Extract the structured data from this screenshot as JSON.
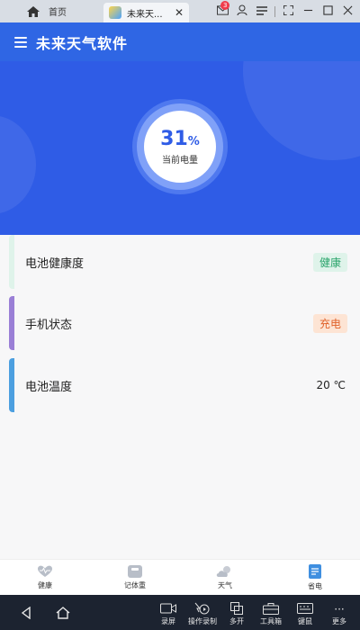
{
  "topbar": {
    "home_tab_label": "首页",
    "active_tab_label": "未来天...",
    "notification_count": "3",
    "close_symbol": "✕",
    "icons": [
      "home-icon",
      "mail-icon",
      "user-icon",
      "menu-icon",
      "screenshot-icon",
      "minimize-icon",
      "maximize-icon",
      "close-icon"
    ]
  },
  "app": {
    "title": "未来天气软件",
    "colors": {
      "header": "#2f66e4",
      "hero": "#2f5ce6"
    }
  },
  "battery": {
    "level_number": "31",
    "level_unit": "%",
    "label": "当前电量"
  },
  "rows": [
    {
      "label": "电池健康度",
      "tag": "健康",
      "stripe_color": "#dff3ea",
      "tag_bg": "#dff3ea",
      "tag_color": "#2aa46b"
    },
    {
      "label": "手机状态",
      "tag": "充电",
      "stripe_color": "#9a7fd6",
      "tag_bg": "#fde4d4",
      "tag_color": "#e0622a"
    },
    {
      "label": "电池温度",
      "value": "20 ℃",
      "stripe_color": "#4c9fe0"
    }
  ],
  "bottom_nav": [
    {
      "label": "健康",
      "icon": "heartbeat-icon"
    },
    {
      "label": "记体重",
      "icon": "scale-icon"
    },
    {
      "label": "天气",
      "icon": "weather-icon"
    },
    {
      "label": "省电",
      "icon": "battery-doc-icon",
      "active": true
    }
  ],
  "system_bar": {
    "items": [
      "录屏",
      "操作录制",
      "多开",
      "工具箱",
      "键鼠",
      "更多"
    ],
    "more_symbol": "···"
  }
}
